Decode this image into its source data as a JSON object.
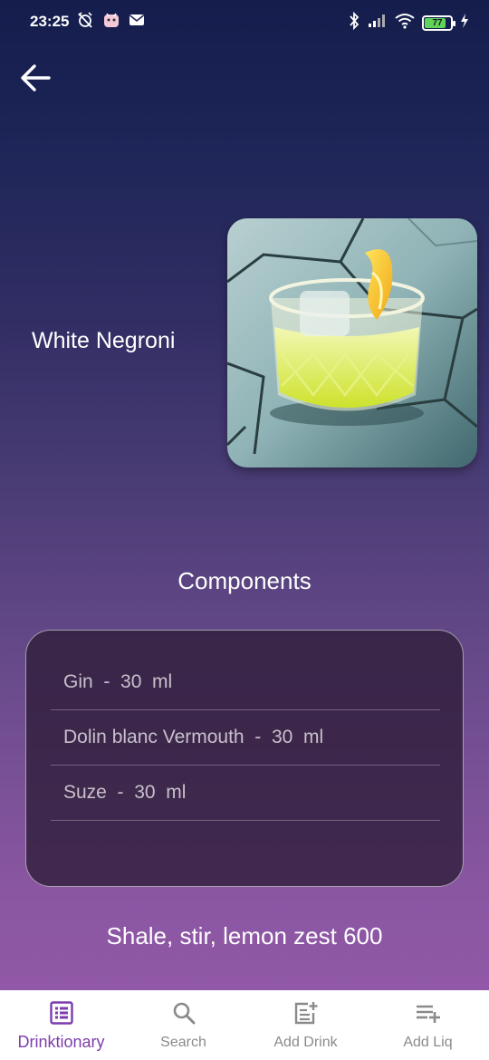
{
  "status_bar": {
    "time": "23:25",
    "battery_level": "77",
    "battery_fraction": 0.77
  },
  "drink": {
    "name": "White Negroni",
    "photo_icon": "cocktail-photo"
  },
  "components": {
    "title": "Components",
    "items": [
      {
        "name": "Gin",
        "amount": "30",
        "unit": "ml",
        "text": "Gin  -  30  ml"
      },
      {
        "name": "Dolin blanc Vermouth",
        "amount": "30",
        "unit": "ml",
        "text": "Dolin blanc Vermouth  -  30  ml"
      },
      {
        "name": "Suze",
        "amount": "30",
        "unit": "ml",
        "text": "Suze  -  30  ml"
      }
    ]
  },
  "instructions": "Shale, stir, lemon zest 600",
  "bottom_nav": {
    "items": [
      {
        "label": "Drinktionary",
        "icon": "list-icon",
        "active": true
      },
      {
        "label": "Search",
        "icon": "search-icon",
        "active": false
      },
      {
        "label": "Add Drink",
        "icon": "add-note-icon",
        "active": false
      },
      {
        "label": "Add Liq",
        "icon": "playlist-add-icon",
        "active": false
      }
    ]
  },
  "colors": {
    "accent": "#7d3cae",
    "nav_inactive": "#8a8a8a",
    "background_top": "#141d4c",
    "background_bottom": "#9058a6"
  }
}
